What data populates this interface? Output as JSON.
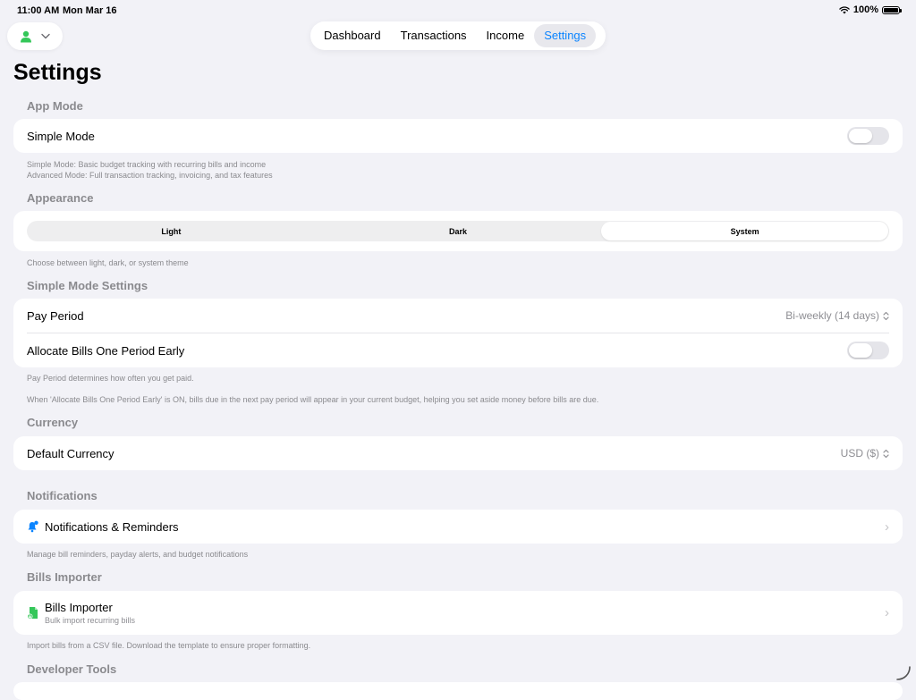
{
  "status": {
    "time": "11:00 AM",
    "date": "Mon Mar 16",
    "battery": "100%",
    "battery_level": 1.0
  },
  "profile": {
    "icon": "person-icon",
    "chevron": "chevron-down-icon"
  },
  "tabs": [
    {
      "label": "Dashboard"
    },
    {
      "label": "Transactions"
    },
    {
      "label": "Income"
    },
    {
      "label": "Settings"
    }
  ],
  "active_tab": "Settings",
  "page_title": "Settings",
  "app_mode": {
    "header": "App Mode",
    "simple_mode_label": "Simple Mode",
    "simple_mode_on": false,
    "footer_line1": "Simple Mode: Basic budget tracking with recurring bills and income",
    "footer_line2": "Advanced Mode: Full transaction tracking, invoicing, and tax features"
  },
  "appearance": {
    "header": "Appearance",
    "options": [
      "Light",
      "Dark",
      "System"
    ],
    "selected": "System",
    "footer": "Choose between light, dark, or system theme"
  },
  "simple_mode_settings": {
    "header": "Simple Mode Settings",
    "pay_period_label": "Pay Period",
    "pay_period_value": "Bi-weekly (14 days)",
    "allocate_label": "Allocate Bills One Period Early",
    "allocate_on": false,
    "footer1": "Pay Period determines how often you get paid.",
    "footer2": "When 'Allocate Bills One Period Early' is ON, bills due in the next pay period will appear in your current budget, helping you set aside money before bills are due."
  },
  "currency": {
    "header": "Currency",
    "label": "Default Currency",
    "value": "USD ($)"
  },
  "notifications": {
    "header": "Notifications",
    "label": "Notifications & Reminders",
    "icon": "bell-badge-icon",
    "footer": "Manage bill reminders, payday alerts, and budget notifications"
  },
  "bills_importer": {
    "header": "Bills Importer",
    "label": "Bills Importer",
    "sublabel": "Bulk import recurring bills",
    "icon": "document-import-icon",
    "footer": "Import bills from a CSV file. Download the template to ensure proper formatting."
  },
  "developer_tools": {
    "header": "Developer Tools"
  },
  "colors": {
    "accent": "#0a84ff",
    "green": "#34c759",
    "background": "#f2f2f7",
    "secondary_text": "#8a8a8e"
  }
}
